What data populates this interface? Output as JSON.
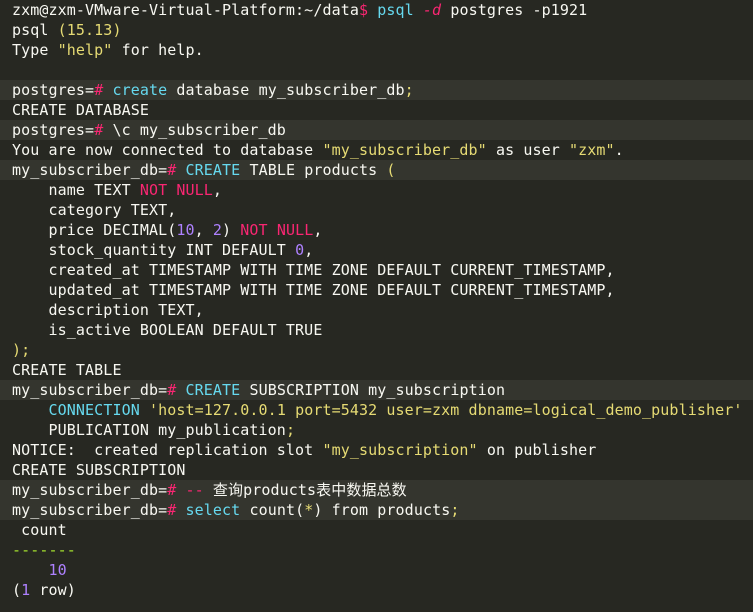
{
  "colors": {
    "background": "#272822",
    "highlight_line": "#34352e",
    "text": "#f8f8f2",
    "prompt_symbol": "#f92672",
    "keyword": "#66d9ef",
    "number": "#ae81ff",
    "string": "#e6db74",
    "separator": "#a6e22e"
  },
  "terminal": {
    "lines": [
      {
        "hl": false,
        "segments": [
          {
            "t": "zxm@zxm-VMware-Virtual-Platform:~/data",
            "c": "default"
          },
          {
            "t": "$",
            "c": "prompt"
          },
          {
            "t": " ",
            "c": "default"
          },
          {
            "t": "psql",
            "c": "kw"
          },
          {
            "t": " ",
            "c": "default"
          },
          {
            "t": "-d",
            "c": "arg"
          },
          {
            "t": " postgres ",
            "c": "default"
          },
          {
            "t": "-p1921",
            "c": "default"
          }
        ]
      },
      {
        "hl": false,
        "segments": [
          {
            "t": "psql ",
            "c": "default"
          },
          {
            "t": "(15.13)",
            "c": "str"
          }
        ]
      },
      {
        "hl": false,
        "segments": [
          {
            "t": "Type ",
            "c": "default"
          },
          {
            "t": "\"help\"",
            "c": "str"
          },
          {
            "t": " for help.",
            "c": "default"
          }
        ]
      },
      {
        "hl": false,
        "segments": [
          {
            "t": "",
            "c": "default"
          }
        ]
      },
      {
        "hl": true,
        "segments": [
          {
            "t": "postgres=",
            "c": "default"
          },
          {
            "t": "#",
            "c": "prompt"
          },
          {
            "t": " ",
            "c": "default"
          },
          {
            "t": "create",
            "c": "kw"
          },
          {
            "t": " database my_subscriber_db",
            "c": "default"
          },
          {
            "t": ";",
            "c": "str"
          }
        ]
      },
      {
        "hl": false,
        "segments": [
          {
            "t": "CREATE DATABASE",
            "c": "default"
          }
        ]
      },
      {
        "hl": true,
        "segments": [
          {
            "t": "postgres=",
            "c": "default"
          },
          {
            "t": "#",
            "c": "prompt"
          },
          {
            "t": " \\c my_subscriber_db",
            "c": "default"
          }
        ]
      },
      {
        "hl": false,
        "segments": [
          {
            "t": "You are now connected to database ",
            "c": "default"
          },
          {
            "t": "\"my_subscriber_db\"",
            "c": "str"
          },
          {
            "t": " as user ",
            "c": "default"
          },
          {
            "t": "\"zxm\"",
            "c": "str"
          },
          {
            "t": ".",
            "c": "default"
          }
        ]
      },
      {
        "hl": true,
        "segments": [
          {
            "t": "my_subscriber_db=",
            "c": "default"
          },
          {
            "t": "#",
            "c": "prompt"
          },
          {
            "t": " ",
            "c": "default"
          },
          {
            "t": "CREATE",
            "c": "kw"
          },
          {
            "t": " TABLE products ",
            "c": "default"
          },
          {
            "t": "(",
            "c": "str"
          }
        ]
      },
      {
        "hl": false,
        "segments": [
          {
            "t": "    name TEXT ",
            "c": "default"
          },
          {
            "t": "NOT NULL",
            "c": "red"
          },
          {
            "t": ",",
            "c": "default"
          }
        ]
      },
      {
        "hl": false,
        "segments": [
          {
            "t": "    category TEXT,",
            "c": "default"
          }
        ]
      },
      {
        "hl": false,
        "segments": [
          {
            "t": "    price DECIMAL(",
            "c": "default"
          },
          {
            "t": "10",
            "c": "num"
          },
          {
            "t": ", ",
            "c": "default"
          },
          {
            "t": "2",
            "c": "num"
          },
          {
            "t": ") ",
            "c": "default"
          },
          {
            "t": "NOT NULL",
            "c": "red"
          },
          {
            "t": ",",
            "c": "default"
          }
        ]
      },
      {
        "hl": false,
        "segments": [
          {
            "t": "    stock_quantity INT DEFAULT ",
            "c": "default"
          },
          {
            "t": "0",
            "c": "num"
          },
          {
            "t": ",",
            "c": "default"
          }
        ]
      },
      {
        "hl": false,
        "segments": [
          {
            "t": "    created_at TIMESTAMP WITH TIME ZONE DEFAULT CURRENT_TIMESTAMP,",
            "c": "default"
          }
        ]
      },
      {
        "hl": false,
        "segments": [
          {
            "t": "    updated_at TIMESTAMP WITH TIME ZONE DEFAULT CURRENT_TIMESTAMP,",
            "c": "default"
          }
        ]
      },
      {
        "hl": false,
        "segments": [
          {
            "t": "    description TEXT,",
            "c": "default"
          }
        ]
      },
      {
        "hl": false,
        "segments": [
          {
            "t": "    is_active BOOLEAN DEFAULT TRUE",
            "c": "default"
          }
        ]
      },
      {
        "hl": false,
        "segments": [
          {
            "t": ");",
            "c": "str"
          }
        ]
      },
      {
        "hl": false,
        "segments": [
          {
            "t": "CREATE TABLE",
            "c": "default"
          }
        ]
      },
      {
        "hl": true,
        "segments": [
          {
            "t": "my_subscriber_db=",
            "c": "default"
          },
          {
            "t": "#",
            "c": "prompt"
          },
          {
            "t": " ",
            "c": "default"
          },
          {
            "t": "CREATE",
            "c": "kw"
          },
          {
            "t": " SUBSCRIPTION my_subscription",
            "c": "default"
          }
        ]
      },
      {
        "hl": false,
        "segments": [
          {
            "t": "    ",
            "c": "default"
          },
          {
            "t": "CONNECTION",
            "c": "kw"
          },
          {
            "t": " ",
            "c": "default"
          },
          {
            "t": "'host=127.0.0.1 port=5432 user=zxm dbname=logical_demo_publisher'",
            "c": "str"
          }
        ]
      },
      {
        "hl": false,
        "segments": [
          {
            "t": "    PUBLICATION my_publication",
            "c": "default"
          },
          {
            "t": ";",
            "c": "str"
          }
        ]
      },
      {
        "hl": false,
        "segments": [
          {
            "t": "NOTICE:  created replication slot ",
            "c": "default"
          },
          {
            "t": "\"my_subscription\"",
            "c": "str"
          },
          {
            "t": " on publisher",
            "c": "default"
          }
        ]
      },
      {
        "hl": false,
        "segments": [
          {
            "t": "CREATE SUBSCRIPTION",
            "c": "default"
          }
        ]
      },
      {
        "hl": true,
        "segments": [
          {
            "t": "my_subscriber_db=",
            "c": "default"
          },
          {
            "t": "#",
            "c": "prompt"
          },
          {
            "t": " ",
            "c": "default"
          },
          {
            "t": "--",
            "c": "red"
          },
          {
            "t": " 查询products表中数据总数",
            "c": "default"
          }
        ]
      },
      {
        "hl": true,
        "segments": [
          {
            "t": "my_subscriber_db=",
            "c": "default"
          },
          {
            "t": "#",
            "c": "prompt"
          },
          {
            "t": " ",
            "c": "default"
          },
          {
            "t": "select",
            "c": "kw"
          },
          {
            "t": " count(",
            "c": "default"
          },
          {
            "t": "*",
            "c": "str"
          },
          {
            "t": ") from products",
            "c": "default"
          },
          {
            "t": ";",
            "c": "str"
          }
        ]
      },
      {
        "hl": false,
        "segments": [
          {
            "t": " count",
            "c": "default"
          }
        ]
      },
      {
        "hl": false,
        "segments": [
          {
            "t": "-------",
            "c": "sep"
          }
        ]
      },
      {
        "hl": false,
        "segments": [
          {
            "t": "    ",
            "c": "default"
          },
          {
            "t": "10",
            "c": "num"
          }
        ]
      },
      {
        "hl": false,
        "segments": [
          {
            "t": "(",
            "c": "default"
          },
          {
            "t": "1",
            "c": "num"
          },
          {
            "t": " row)",
            "c": "default"
          }
        ]
      }
    ]
  }
}
